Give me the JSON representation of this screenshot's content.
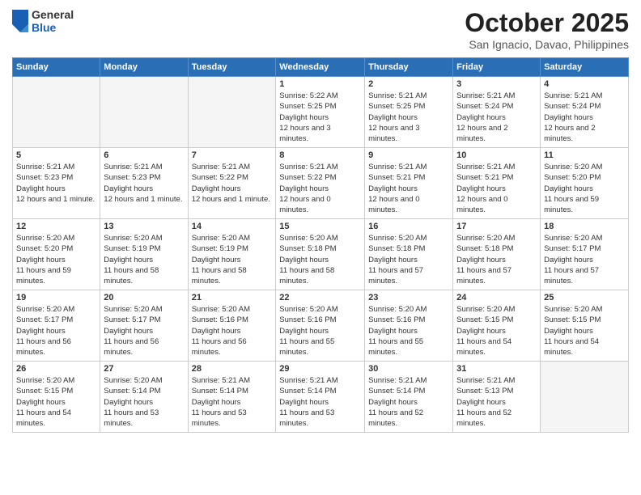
{
  "header": {
    "logo": {
      "general": "General",
      "blue": "Blue"
    },
    "title": "October 2025",
    "location": "San Ignacio, Davao, Philippines"
  },
  "days_of_week": [
    "Sunday",
    "Monday",
    "Tuesday",
    "Wednesday",
    "Thursday",
    "Friday",
    "Saturday"
  ],
  "weeks": [
    [
      {
        "day": "",
        "empty": true
      },
      {
        "day": "",
        "empty": true
      },
      {
        "day": "",
        "empty": true
      },
      {
        "day": "1",
        "sunrise": "5:22 AM",
        "sunset": "5:25 PM",
        "daylight": "12 hours and 3 minutes."
      },
      {
        "day": "2",
        "sunrise": "5:21 AM",
        "sunset": "5:25 PM",
        "daylight": "12 hours and 3 minutes."
      },
      {
        "day": "3",
        "sunrise": "5:21 AM",
        "sunset": "5:24 PM",
        "daylight": "12 hours and 2 minutes."
      },
      {
        "day": "4",
        "sunrise": "5:21 AM",
        "sunset": "5:24 PM",
        "daylight": "12 hours and 2 minutes."
      }
    ],
    [
      {
        "day": "5",
        "sunrise": "5:21 AM",
        "sunset": "5:23 PM",
        "daylight": "12 hours and 1 minute."
      },
      {
        "day": "6",
        "sunrise": "5:21 AM",
        "sunset": "5:23 PM",
        "daylight": "12 hours and 1 minute."
      },
      {
        "day": "7",
        "sunrise": "5:21 AM",
        "sunset": "5:22 PM",
        "daylight": "12 hours and 1 minute."
      },
      {
        "day": "8",
        "sunrise": "5:21 AM",
        "sunset": "5:22 PM",
        "daylight": "12 hours and 0 minutes."
      },
      {
        "day": "9",
        "sunrise": "5:21 AM",
        "sunset": "5:21 PM",
        "daylight": "12 hours and 0 minutes."
      },
      {
        "day": "10",
        "sunrise": "5:21 AM",
        "sunset": "5:21 PM",
        "daylight": "12 hours and 0 minutes."
      },
      {
        "day": "11",
        "sunrise": "5:20 AM",
        "sunset": "5:20 PM",
        "daylight": "11 hours and 59 minutes."
      }
    ],
    [
      {
        "day": "12",
        "sunrise": "5:20 AM",
        "sunset": "5:20 PM",
        "daylight": "11 hours and 59 minutes."
      },
      {
        "day": "13",
        "sunrise": "5:20 AM",
        "sunset": "5:19 PM",
        "daylight": "11 hours and 58 minutes."
      },
      {
        "day": "14",
        "sunrise": "5:20 AM",
        "sunset": "5:19 PM",
        "daylight": "11 hours and 58 minutes."
      },
      {
        "day": "15",
        "sunrise": "5:20 AM",
        "sunset": "5:18 PM",
        "daylight": "11 hours and 58 minutes."
      },
      {
        "day": "16",
        "sunrise": "5:20 AM",
        "sunset": "5:18 PM",
        "daylight": "11 hours and 57 minutes."
      },
      {
        "day": "17",
        "sunrise": "5:20 AM",
        "sunset": "5:18 PM",
        "daylight": "11 hours and 57 minutes."
      },
      {
        "day": "18",
        "sunrise": "5:20 AM",
        "sunset": "5:17 PM",
        "daylight": "11 hours and 57 minutes."
      }
    ],
    [
      {
        "day": "19",
        "sunrise": "5:20 AM",
        "sunset": "5:17 PM",
        "daylight": "11 hours and 56 minutes."
      },
      {
        "day": "20",
        "sunrise": "5:20 AM",
        "sunset": "5:17 PM",
        "daylight": "11 hours and 56 minutes."
      },
      {
        "day": "21",
        "sunrise": "5:20 AM",
        "sunset": "5:16 PM",
        "daylight": "11 hours and 56 minutes."
      },
      {
        "day": "22",
        "sunrise": "5:20 AM",
        "sunset": "5:16 PM",
        "daylight": "11 hours and 55 minutes."
      },
      {
        "day": "23",
        "sunrise": "5:20 AM",
        "sunset": "5:16 PM",
        "daylight": "11 hours and 55 minutes."
      },
      {
        "day": "24",
        "sunrise": "5:20 AM",
        "sunset": "5:15 PM",
        "daylight": "11 hours and 54 minutes."
      },
      {
        "day": "25",
        "sunrise": "5:20 AM",
        "sunset": "5:15 PM",
        "daylight": "11 hours and 54 minutes."
      }
    ],
    [
      {
        "day": "26",
        "sunrise": "5:20 AM",
        "sunset": "5:15 PM",
        "daylight": "11 hours and 54 minutes."
      },
      {
        "day": "27",
        "sunrise": "5:20 AM",
        "sunset": "5:14 PM",
        "daylight": "11 hours and 53 minutes."
      },
      {
        "day": "28",
        "sunrise": "5:21 AM",
        "sunset": "5:14 PM",
        "daylight": "11 hours and 53 minutes."
      },
      {
        "day": "29",
        "sunrise": "5:21 AM",
        "sunset": "5:14 PM",
        "daylight": "11 hours and 53 minutes."
      },
      {
        "day": "30",
        "sunrise": "5:21 AM",
        "sunset": "5:14 PM",
        "daylight": "11 hours and 52 minutes."
      },
      {
        "day": "31",
        "sunrise": "5:21 AM",
        "sunset": "5:13 PM",
        "daylight": "11 hours and 52 minutes."
      },
      {
        "day": "",
        "empty": true
      }
    ]
  ],
  "labels": {
    "sunrise": "Sunrise:",
    "sunset": "Sunset:",
    "daylight": "Daylight hours"
  }
}
